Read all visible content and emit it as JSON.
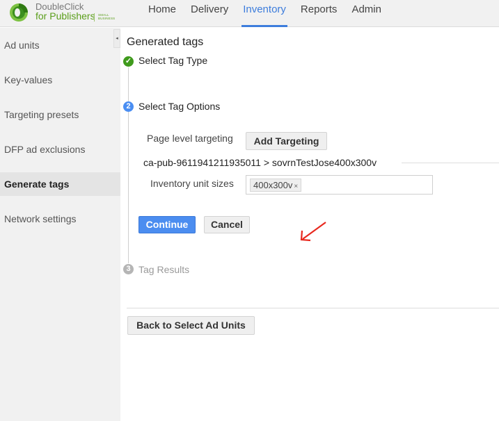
{
  "brand": {
    "line1": "DoubleClick",
    "line2": "for Publishers",
    "edition_line1": "SMALL",
    "edition_line2": "BUSINESS"
  },
  "nav": {
    "items": [
      {
        "label": "Home",
        "active": false
      },
      {
        "label": "Delivery",
        "active": false
      },
      {
        "label": "Inventory",
        "active": true
      },
      {
        "label": "Reports",
        "active": false
      },
      {
        "label": "Admin",
        "active": false
      }
    ]
  },
  "sidebar": {
    "collapse_icon": "◂",
    "items": [
      {
        "label": "Ad units",
        "active": false
      },
      {
        "label": "Key-values",
        "active": false
      },
      {
        "label": "Targeting presets",
        "active": false
      },
      {
        "label": "DFP ad exclusions",
        "active": false
      },
      {
        "label": "Generate tags",
        "active": true
      },
      {
        "label": "Network settings",
        "active": false
      }
    ]
  },
  "main": {
    "title": "Generated tags",
    "steps": [
      {
        "number": "✓",
        "label": "Select Tag Type",
        "status": "complete"
      },
      {
        "number": "2",
        "label": "Select Tag Options",
        "status": "current"
      },
      {
        "number": "3",
        "label": "Tag Results",
        "status": "pending"
      }
    ],
    "page_level_targeting_label": "Page level targeting",
    "add_targeting_label": "Add Targeting",
    "ad_unit_path": "ca-pub-9611941211935011 > sovrnTestJose400x300v",
    "inventory_sizes_label": "Inventory unit sizes",
    "inventory_sizes": [
      {
        "value": "400x300v",
        "remove": "×"
      }
    ],
    "continue_label": "Continue",
    "cancel_label": "Cancel",
    "back_label": "Back to Select Ad Units"
  },
  "colors": {
    "accent": "#3d7ddc",
    "primary_button": "#4b8df0",
    "step_complete": "#3f9a1c",
    "step_current": "#4a8ef2",
    "step_pending": "#b5b5b5",
    "annotation_arrow": "#e8281e"
  }
}
